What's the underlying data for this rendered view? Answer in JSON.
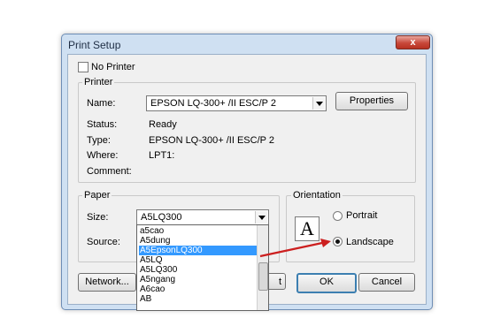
{
  "window": {
    "title": "Print Setup",
    "close_glyph": "x"
  },
  "no_printer": {
    "label": "No Printer",
    "checked": false
  },
  "printer": {
    "group_label": "Printer",
    "name_label": "Name:",
    "name_value": "EPSON LQ-300+ /II ESC/P 2",
    "properties_button": "Properties",
    "status_label": "Status:",
    "status_value": "Ready",
    "type_label": "Type:",
    "type_value": "EPSON LQ-300+ /II ESC/P 2",
    "where_label": "Where:",
    "where_value": "LPT1:",
    "comment_label": "Comment:",
    "comment_value": ""
  },
  "paper": {
    "group_label": "Paper",
    "size_label": "Size:",
    "size_value": "A5LQ300",
    "source_label": "Source:",
    "dropdown_items": [
      "a5cao",
      "A5dung",
      "A5EpsonLQ300",
      "A5LQ",
      "A5LQ300",
      "A5ngang",
      "A6cao",
      "AB"
    ],
    "selected_index": 2
  },
  "orientation": {
    "group_label": "Orientation",
    "icon_letter": "A",
    "portrait_label": "Portrait",
    "landscape_label": "Landscape",
    "selected": "Landscape"
  },
  "buttons": {
    "network": "Network...",
    "hidden_fragment": "t",
    "ok": "OK",
    "cancel": "Cancel"
  },
  "colors": {
    "selection": "#3399ff",
    "arrow": "#cc1f1f",
    "window_frame": "#cfe0f2"
  }
}
